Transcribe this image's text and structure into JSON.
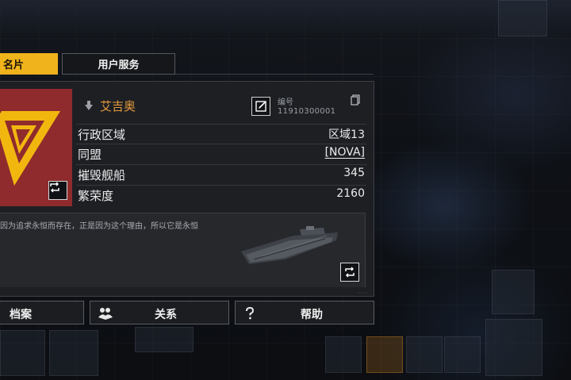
{
  "tabs": {
    "card_label": "名片",
    "service_label": "用户服务"
  },
  "profile": {
    "name": "艾吉奥",
    "id_label": "编号",
    "id_value": "11910300001",
    "rows": [
      {
        "label": "行政区域",
        "value": "区域13"
      },
      {
        "label": "同盟",
        "value": "[NOVA]"
      },
      {
        "label": "摧毁舰船",
        "value": "345"
      },
      {
        "label": "繁荣度",
        "value": "2160"
      }
    ],
    "motto": "因为追求永恒而存在，正是因为这个理由，所以它是永恒"
  },
  "buttons": {
    "archive": "档案",
    "relations": "关系",
    "help": "帮助"
  },
  "colors": {
    "accent": "#f0b31b",
    "emblem_bg": "#8f2b2d",
    "name": "#e79b3e"
  },
  "icons": [
    "refresh-icon",
    "edit-icon",
    "copy-icon",
    "location-pin-icon",
    "relations-icon",
    "help-icon"
  ]
}
